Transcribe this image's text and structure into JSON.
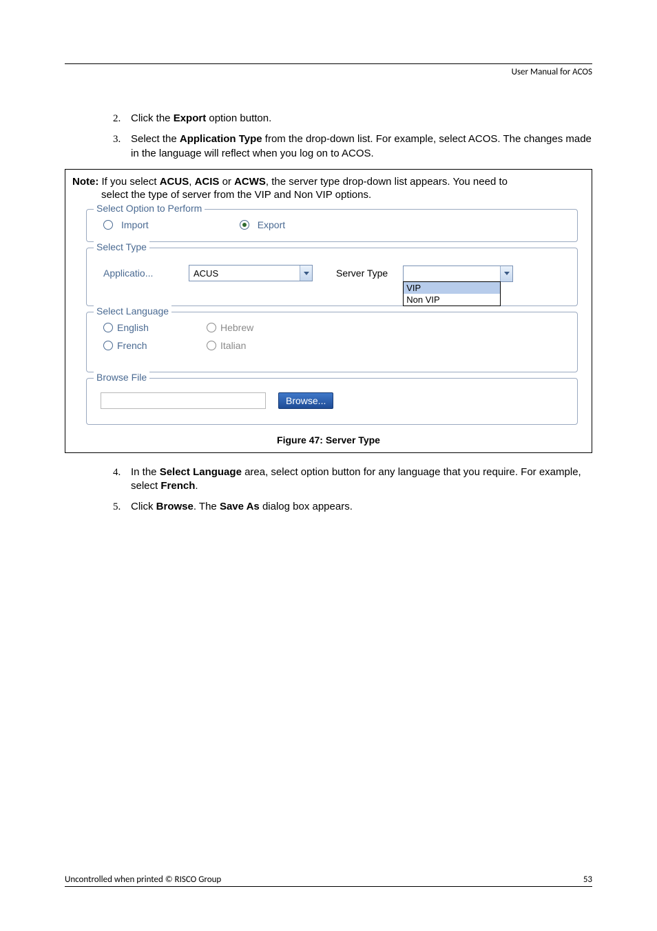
{
  "header": {
    "title": "User Manual for ACOS"
  },
  "steps": {
    "s2": {
      "num": "2.",
      "pre": "Click the ",
      "bold": "Export",
      "post": " option button."
    },
    "s3": {
      "num": "3.",
      "pre": "Select the ",
      "bold": "Application Type",
      "post": " from the drop-down list. For example, select ACOS. The changes made in the language will reflect when you log on to ACOS."
    },
    "s4": {
      "num": "4.",
      "pre": "In the ",
      "bold": "Select Language",
      "mid": " area, select option button for any language that you require. For example, select ",
      "bold2": "French",
      "post": "."
    },
    "s5": {
      "num": "5.",
      "pre": "Click ",
      "bold": "Browse",
      "mid": ". The ",
      "bold2": "Save As",
      "post": " dialog box appears."
    }
  },
  "note": {
    "label": "Note:",
    "line1a": " If you select ",
    "b1": "ACUS",
    "c1": ", ",
    "b2": "ACIS",
    "c2": " or ",
    "b3": "ACWS",
    "line1b": ", the server type drop-down list appears. You need to",
    "line2": "select the type of server from the VIP and Non VIP options."
  },
  "ui": {
    "group1": {
      "legend": "Select Option to Perform",
      "import": "Import",
      "export": "Export"
    },
    "group2": {
      "legend": "Select Type",
      "appLabel": "Applicatio...",
      "appValue": "ACUS",
      "srvLabel": "Server Type",
      "opt1": "VIP",
      "opt2": "Non VIP"
    },
    "group3": {
      "legend": "Select Language",
      "english": "English",
      "hebrew": "Hebrew",
      "french": "French",
      "italian": "Italian"
    },
    "group4": {
      "legend": "Browse File",
      "browse": "Browse..."
    }
  },
  "figure": {
    "caption": "Figure 47: Server Type"
  },
  "footer": {
    "left": "Uncontrolled when printed © RISCO Group",
    "right": "53"
  }
}
